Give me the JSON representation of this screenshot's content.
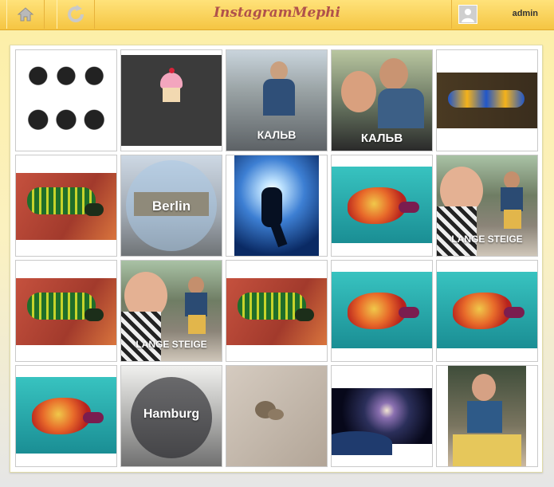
{
  "app": {
    "title": "InstagramMephi"
  },
  "user": {
    "name": "admin"
  },
  "toolbar": {
    "home_icon": "home-icon",
    "refresh_icon": "refresh-icon"
  },
  "photos": [
    {
      "name": "photo-beards",
      "type": "beards"
    },
    {
      "name": "photo-cupcake",
      "type": "cupcake"
    },
    {
      "name": "photo-kalv-boy",
      "type": "kalv-boy",
      "text": "КАЛЬВ"
    },
    {
      "name": "photo-kalv-couple",
      "type": "kalv-couple",
      "text": "КАЛЬВ"
    },
    {
      "name": "photo-nudibranch-blue",
      "type": "nudi-blue"
    },
    {
      "name": "photo-nudibranch-green-1",
      "type": "nudi-green"
    },
    {
      "name": "photo-berlin",
      "type": "berlin",
      "text": "Berlin"
    },
    {
      "name": "photo-diver",
      "type": "diver"
    },
    {
      "name": "photo-nudibranch-red-1",
      "type": "nudi-red"
    },
    {
      "name": "photo-lange-steige-1",
      "type": "lange",
      "text": "LANGE STEIGE"
    },
    {
      "name": "photo-nudibranch-green-2",
      "type": "nudi-green"
    },
    {
      "name": "photo-lange-steige-2",
      "type": "lange",
      "text": "LANGE STEIGE"
    },
    {
      "name": "photo-nudibranch-green-3",
      "type": "nudi-green"
    },
    {
      "name": "photo-nudibranch-red-2",
      "type": "nudi-red"
    },
    {
      "name": "photo-nudibranch-red-3",
      "type": "nudi-red"
    },
    {
      "name": "photo-nudibranch-red-4",
      "type": "nudi-red"
    },
    {
      "name": "photo-hamburg",
      "type": "hamburg",
      "text": "Hamburg"
    },
    {
      "name": "photo-cat",
      "type": "cat"
    },
    {
      "name": "photo-galaxy",
      "type": "galaxy"
    },
    {
      "name": "photo-man-eating",
      "type": "man"
    }
  ]
}
